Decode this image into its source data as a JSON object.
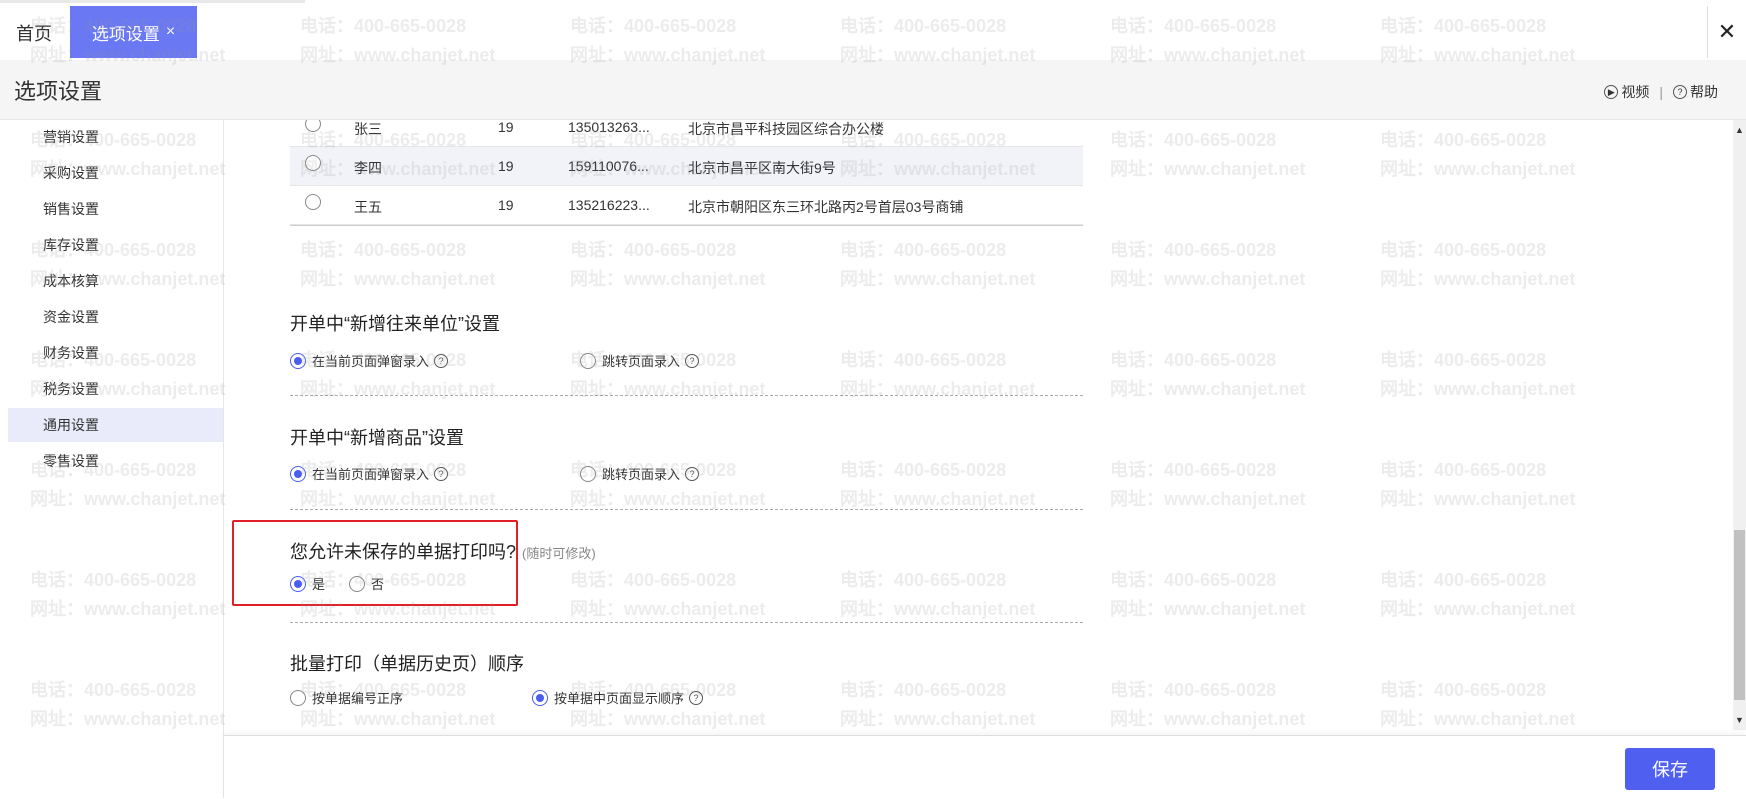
{
  "tabs": {
    "home": "首页",
    "active": "选项设置",
    "close_glyph": "×"
  },
  "window_close": "✕",
  "header": {
    "title": "选项设置",
    "video": "视频",
    "separator": "|",
    "help": "帮助"
  },
  "sidebar": {
    "items": [
      {
        "label": "营销设置"
      },
      {
        "label": "采购设置"
      },
      {
        "label": "销售设置"
      },
      {
        "label": "库存设置"
      },
      {
        "label": "成本核算"
      },
      {
        "label": "资金设置"
      },
      {
        "label": "财务设置"
      },
      {
        "label": "税务设置"
      },
      {
        "label": "通用设置",
        "active": true
      },
      {
        "label": "零售设置"
      }
    ]
  },
  "contacts": {
    "rows": [
      {
        "name": "张三",
        "age": "19",
        "phone": "135013263...",
        "address": "北京市昌平科技园区综合办公楼"
      },
      {
        "name": "李四",
        "age": "19",
        "phone": "159110076...",
        "address": "北京市昌平区南大街9号"
      },
      {
        "name": "王五",
        "age": "19",
        "phone": "135216223...",
        "address": "北京市朝阳区东三环北路丙2号首层03号商铺"
      }
    ]
  },
  "sections": {
    "new_partner": {
      "title": "开单中“新增往来单位”设置",
      "opt1": "在当前页面弹窗录入",
      "opt2": "跳转页面录入",
      "selected": "opt1"
    },
    "new_product": {
      "title": "开单中“新增商品”设置",
      "opt1": "在当前页面弹窗录入",
      "opt2": "跳转页面录入",
      "selected": "opt1"
    },
    "print_unsaved": {
      "title": "您允许未保存的单据打印吗?",
      "hint": "(随时可修改)",
      "yes": "是",
      "no": "否",
      "selected": "yes"
    },
    "batch_print": {
      "title": "批量打印（单据历史页）顺序",
      "opt1": "按单据编号正序",
      "opt2": "按单据中页面显示顺序",
      "selected": "opt2"
    }
  },
  "footer": {
    "save": "保存"
  },
  "watermark": {
    "phone": "电话：400-665-0028",
    "site": "网址：www.chanjet.net"
  },
  "colors": {
    "accent": "#4f5ff0",
    "tab_active": "#6a78f3",
    "highlight": "#e01f26"
  }
}
